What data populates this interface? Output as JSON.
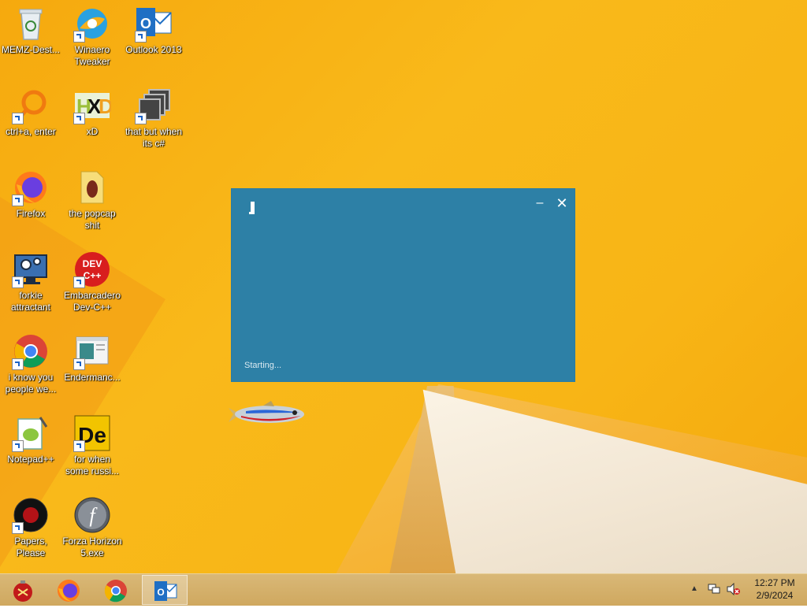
{
  "desktop": {
    "icons": [
      {
        "id": "memz",
        "label": "MEMZ-Dest...",
        "icon": "recycle-bin-icon"
      },
      {
        "id": "winaero",
        "label": "Winaero Tweaker",
        "icon": "winaero-icon"
      },
      {
        "id": "outlook",
        "label": "Outlook 2013",
        "icon": "outlook-icon"
      },
      {
        "id": "ctrl",
        "label": "ctrl+a, enter",
        "icon": "magnifier-icon"
      },
      {
        "id": "xd",
        "label": "xD",
        "icon": "hxd-icon"
      },
      {
        "id": "csharp",
        "label": "that but when its c#",
        "icon": "windows-stack-icon"
      },
      {
        "id": "firefox",
        "label": "Firefox",
        "icon": "firefox-icon"
      },
      {
        "id": "popcap",
        "label": "the popcap shit",
        "icon": "folder-icon"
      },
      {
        "id": "forkie",
        "label": "forkie attractant",
        "icon": "monitor-gear-icon"
      },
      {
        "id": "devcpp",
        "label": "Embarcadero Dev-C++",
        "icon": "devcpp-icon"
      },
      {
        "id": "chrome",
        "label": "i know you people we...",
        "icon": "chrome-icon"
      },
      {
        "id": "enderman",
        "label": "Endermanc...",
        "icon": "window-app-icon"
      },
      {
        "id": "notepadpp",
        "label": "Notepad++",
        "icon": "notepadpp-icon"
      },
      {
        "id": "russian",
        "label": "for when some russi...",
        "icon": "de-icon"
      },
      {
        "id": "papers",
        "label": "Papers, Please",
        "icon": "papers-please-icon"
      },
      {
        "id": "forza",
        "label": "Forza Horizon 5.exe",
        "icon": "flash-icon"
      }
    ]
  },
  "app_window": {
    "status": "Starting...",
    "minimize_glyph": "–",
    "close_glyph": "✕"
  },
  "taskbar": {
    "buttons": [
      "start-orb-icon",
      "firefox-icon",
      "chrome-icon",
      "outlook-icon"
    ],
    "tray": {
      "arrow": "▲",
      "network_icon": "network-icon",
      "volume_icon": "volume-muted-icon"
    },
    "clock": {
      "time": "12:27 PM",
      "date": "2/9/2024"
    }
  },
  "colors": {
    "window_bg": "#2d80a6",
    "desktop_bg": "#f8b516",
    "taskbar_bg": "#d4ae68"
  }
}
